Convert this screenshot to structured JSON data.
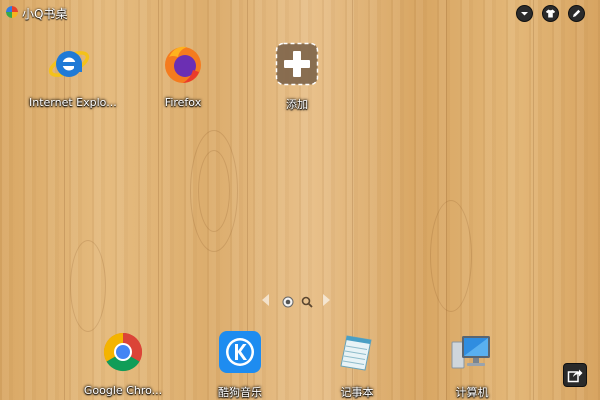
{
  "app": {
    "title": "小Q书桌",
    "logo_icon": "windmill-logo-icon"
  },
  "titlebar_buttons": [
    {
      "name": "menu-dropdown-button",
      "icon": "chevron-down-icon"
    },
    {
      "name": "skin-button",
      "icon": "shirt-icon"
    },
    {
      "name": "edit-button",
      "icon": "pencil-icon"
    }
  ],
  "desktop": {
    "top_icons": [
      {
        "label": "Internet Explo...",
        "icon": "internet-explorer-icon"
      },
      {
        "label": "Firefox",
        "icon": "firefox-icon"
      },
      {
        "label": "添加",
        "icon": "add-icon"
      }
    ],
    "dock_icons": [
      {
        "label": "Google Chro...",
        "icon": "chrome-icon"
      },
      {
        "label": "酷狗音乐",
        "icon": "kugou-music-icon"
      },
      {
        "label": "记事本",
        "icon": "notepad-icon"
      },
      {
        "label": "计算机",
        "icon": "computer-icon"
      }
    ]
  },
  "pager": {
    "current_page": 1,
    "page_count": 1
  },
  "colors": {
    "wood_base": "#e0b373",
    "ie_blue": "#1f7ad6",
    "kugou_blue": "#1e8cf0"
  }
}
